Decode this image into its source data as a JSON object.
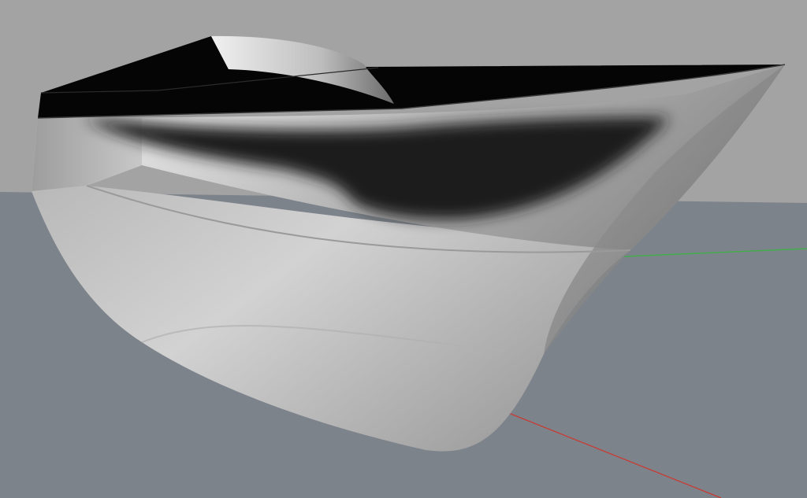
{
  "viewport": {
    "sky_color": "#a3a3a3",
    "ground_color": "#7d838b",
    "hull_light": "#d8d8d8",
    "hull_mid": "#a9a9a9",
    "hull_dark": "#777777",
    "deck_color": "#050505",
    "shadow_color": "#1e1e1e",
    "cabin_light": "#e2e2e2",
    "cabin_dark": "#5c5c5c"
  },
  "axes": {
    "x_axis_color": "#c83a32",
    "y_axis_color": "#3bb143"
  }
}
